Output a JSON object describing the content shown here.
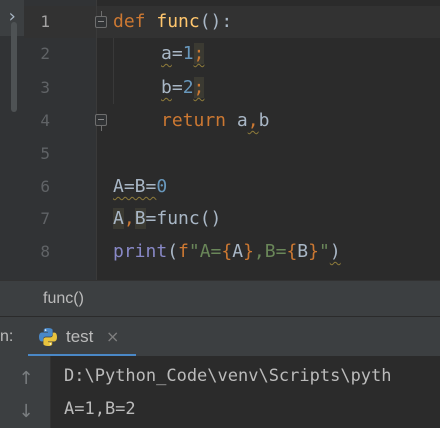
{
  "editor": {
    "line_numbers": [
      "1",
      "2",
      "3",
      "4",
      "5",
      "6",
      "7",
      "8"
    ],
    "lines": {
      "l1": {
        "kw": "def",
        "fn": "func",
        "rest": "():"
      },
      "l2": {
        "var": "a",
        "eq": "=",
        "num": "1",
        "semi": ";"
      },
      "l3": {
        "var": "b",
        "eq": "=",
        "num": "2",
        "semi": ";"
      },
      "l4": {
        "kw": "return",
        "a": "a",
        "comma": ",",
        "b": "b"
      },
      "l6": {
        "text": "A=B=",
        "num": "0"
      },
      "l7": {
        "a": "A",
        "comma": ",",
        "b": "B",
        "rest": "=func()"
      },
      "l8": {
        "bi": "print",
        "open": "(",
        "prefix": "f",
        "str1": "\"A=",
        "br1o": "{",
        "v1": "A",
        "br1c": "}",
        "str2": ",B=",
        "br2o": "{",
        "v2": "B",
        "br2c": "}",
        "str3": "\"",
        "close": ")"
      }
    }
  },
  "breadcrumb": {
    "label": "func()"
  },
  "run": {
    "prefix": "n:",
    "tab_label": "test",
    "close_glyph": "×",
    "up_glyph": "↑",
    "down_glyph": "↓",
    "output": [
      "D:\\Python_Code\\venv\\Scripts\\pyth",
      "A=1,B=2"
    ]
  },
  "icons": {
    "chevron": "chevron-right-icon",
    "python": "python-icon"
  },
  "colors": {
    "keyword": "#cc7832",
    "function": "#ffc66d",
    "number": "#6897bb",
    "string": "#6a8759",
    "builtin": "#8888c6",
    "accent": "#4a88c7"
  }
}
